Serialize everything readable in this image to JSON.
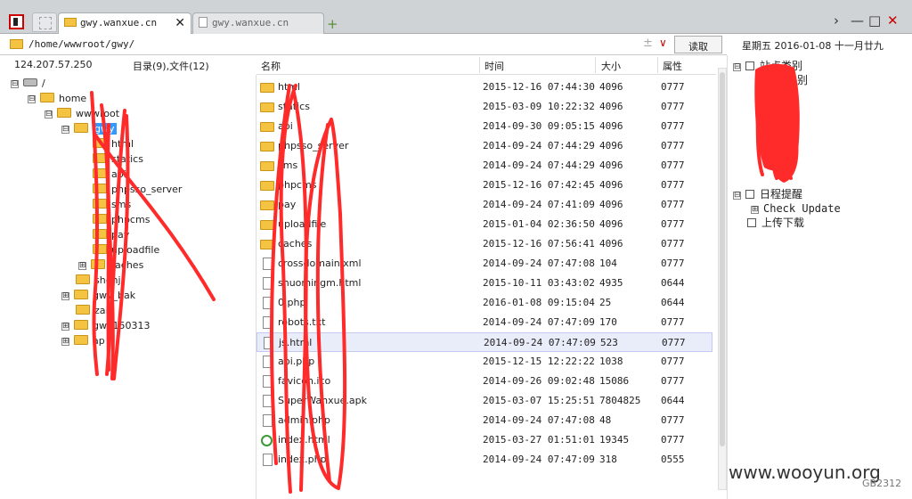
{
  "tabs": [
    {
      "title": "gwy.wanxue.cn",
      "close": "✕"
    },
    {
      "title": "gwy.wanxue.cn"
    }
  ],
  "tab_add": "+",
  "window_controls": {
    "next": "›",
    "minimize": "—",
    "maximize": "□",
    "close": "✕"
  },
  "address": {
    "path": "/home/wwwroot/gwy/",
    "read_button": "读取"
  },
  "date_display": "星期五  2016-01-08  十一月廿九",
  "server_ip": "124.207.57.250",
  "counts_label": "目录(9),文件(12)",
  "tree": [
    {
      "label": "/",
      "indent": 0,
      "expander": "⊟",
      "icon": "drive"
    },
    {
      "label": "home",
      "indent": 1,
      "expander": "⊟",
      "icon": "folder"
    },
    {
      "label": "wwwroot",
      "indent": 2,
      "expander": "⊟",
      "icon": "folder"
    },
    {
      "label": "gwy",
      "indent": 3,
      "expander": "⊟",
      "icon": "folder",
      "selected": true
    },
    {
      "label": "html",
      "indent": 4,
      "expander": "",
      "icon": "folder"
    },
    {
      "label": "statics",
      "indent": 4,
      "expander": "",
      "icon": "folder"
    },
    {
      "label": "api",
      "indent": 4,
      "expander": "",
      "icon": "folder"
    },
    {
      "label": "phpsso_server",
      "indent": 4,
      "expander": "",
      "icon": "folder"
    },
    {
      "label": "sms",
      "indent": 4,
      "expander": "",
      "icon": "folder"
    },
    {
      "label": "phpcms",
      "indent": 4,
      "expander": "",
      "icon": "folder"
    },
    {
      "label": "pay",
      "indent": 4,
      "expander": "",
      "icon": "folder"
    },
    {
      "label": "uploadfile",
      "indent": 4,
      "expander": "",
      "icon": "folder"
    },
    {
      "label": "caches",
      "indent": 4,
      "expander": "⊞",
      "icon": "folder"
    },
    {
      "label": "shenji",
      "indent": 3,
      "expander": "",
      "icon": "folder"
    },
    {
      "label": "gwy_bak",
      "indent": 3,
      "expander": "⊞",
      "icon": "folder"
    },
    {
      "label": "zai",
      "indent": 3,
      "expander": "",
      "icon": "folder"
    },
    {
      "label": "gwy150313",
      "indent": 3,
      "expander": "⊞",
      "icon": "folder"
    },
    {
      "label": "ap",
      "indent": 3,
      "expander": "⊞",
      "icon": "folder"
    }
  ],
  "columns": {
    "name": "名称",
    "time": "时间",
    "size": "大小",
    "attr": "属性"
  },
  "files": [
    {
      "name": "html",
      "time": "2015-12-16 07:44:30",
      "size": "4096",
      "attr": "0777",
      "type": "folder"
    },
    {
      "name": "statics",
      "time": "2015-03-09 10:22:32",
      "size": "4096",
      "attr": "0777",
      "type": "folder"
    },
    {
      "name": "api",
      "time": "2014-09-30 09:05:15",
      "size": "4096",
      "attr": "0777",
      "type": "folder"
    },
    {
      "name": "phpsso_server",
      "time": "2014-09-24 07:44:29",
      "size": "4096",
      "attr": "0777",
      "type": "folder"
    },
    {
      "name": "sms",
      "time": "2014-09-24 07:44:29",
      "size": "4096",
      "attr": "0777",
      "type": "folder"
    },
    {
      "name": "phpcms",
      "time": "2015-12-16 07:42:45",
      "size": "4096",
      "attr": "0777",
      "type": "folder"
    },
    {
      "name": "pay",
      "time": "2014-09-24 07:41:09",
      "size": "4096",
      "attr": "0777",
      "type": "folder"
    },
    {
      "name": "uploadfile",
      "time": "2015-01-04 02:36:50",
      "size": "4096",
      "attr": "0777",
      "type": "folder"
    },
    {
      "name": "caches",
      "time": "2015-12-16 07:56:41",
      "size": "4096",
      "attr": "0777",
      "type": "folder"
    },
    {
      "name": "crossdomain.xml",
      "time": "2014-09-24 07:47:08",
      "size": "104",
      "attr": "0777",
      "type": "file"
    },
    {
      "name": "shuomingm.html",
      "time": "2015-10-11 03:43:02",
      "size": "4935",
      "attr": "0644",
      "type": "file"
    },
    {
      "name": "0.php",
      "time": "2016-01-08 09:15:04",
      "size": "25",
      "attr": "0644",
      "type": "file"
    },
    {
      "name": "robots.txt",
      "time": "2014-09-24 07:47:09",
      "size": "170",
      "attr": "0777",
      "type": "file"
    },
    {
      "name": "js.html",
      "time": "2014-09-24 07:47:09",
      "size": "523",
      "attr": "0777",
      "type": "file",
      "highlight": true
    },
    {
      "name": "api.php",
      "time": "2015-12-15 12:22:22",
      "size": "1038",
      "attr": "0777",
      "type": "file"
    },
    {
      "name": "favicon.ico",
      "time": "2014-09-26 09:02:48",
      "size": "15086",
      "attr": "0777",
      "type": "file"
    },
    {
      "name": "SuperWanxue.apk",
      "time": "2015-03-07 15:25:51",
      "size": "7804825",
      "attr": "0644",
      "type": "file"
    },
    {
      "name": "admin.php",
      "time": "2014-09-24 07:47:08",
      "size": "48",
      "attr": "0777",
      "type": "file"
    },
    {
      "name": "index.html",
      "time": "2015-03-27 01:51:01",
      "size": "19345",
      "attr": "0777",
      "type": "ie"
    },
    {
      "name": "index.php",
      "time": "2014-09-24 07:47:09",
      "size": "318",
      "attr": "0555",
      "type": "file"
    }
  ],
  "right_panel": [
    {
      "label": "站点类别",
      "expander": "⊟",
      "icon": "sq",
      "indent": 0
    },
    {
      "label": "站点类别",
      "expander": "",
      "icon": "",
      "indent": 1
    },
    {
      "label": "日程提醒",
      "expander": "⊟",
      "icon": "sq",
      "indent": 0
    },
    {
      "label": "Check Update",
      "expander": "⊞",
      "icon": "",
      "indent": 1
    },
    {
      "label": "上传下载",
      "expander": "",
      "icon": "sq",
      "indent": 0
    }
  ],
  "watermark": "www.wooyun.org",
  "encoding": "GB2312",
  "colors": {
    "selection": "#3399ff",
    "highlight_row": "#e9ecf9",
    "scribble": "#ff2a2a",
    "folder": "#f5c342",
    "close_red": "#cc0000"
  }
}
